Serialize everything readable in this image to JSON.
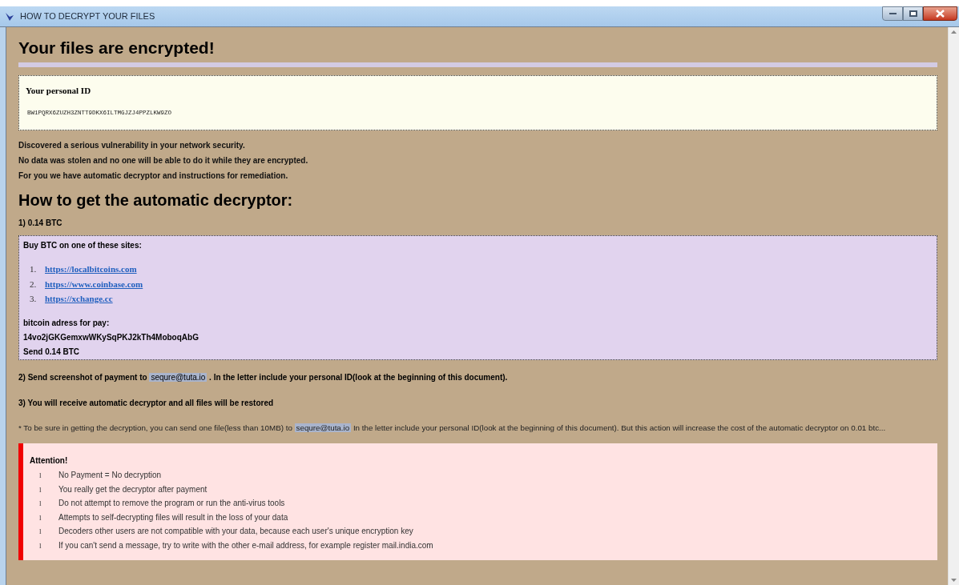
{
  "window": {
    "title": "HOW TO DECRYPT YOUR FILES"
  },
  "heading": "Your files are encrypted!",
  "id_box": {
    "label": "Your personal ID",
    "value": "BW1PQRX6ZUZH3ZNTT9DKX6ILTMGJZJ4PPZLKW9ZO"
  },
  "intro": [
    "Discovered a serious vulnerability in your network security.",
    "No data was stolen and no one will be able to do it while they are encrypted.",
    "For you we have automatic decryptor and instructions for remediation."
  ],
  "subheading": "How to get the automatic decryptor:",
  "step_1": "1) 0.14 BTC",
  "buy_box": {
    "title": "Buy BTC on one of these sites:",
    "sites": [
      {
        "number": "1.",
        "url": "https://localbitcoins.com"
      },
      {
        "number": "2.",
        "url": "https://www.coinbase.com"
      },
      {
        "number": "3.",
        "url": "https://xchange.cc"
      }
    ],
    "address_label": "bitcoin adress for pay:",
    "address": "14vo2jGKGemxwWKySqPKJ2kTh4MoboqAbG",
    "send": "Send 0.14 BTC"
  },
  "step_2": {
    "before": "2) Send screenshot of payment to",
    "email": "sequre@tuta.io",
    "after": ". In the letter include your personal ID(look at the beginning of this document)."
  },
  "step_3": "3) You will receive automatic decryptor and all files will be restored",
  "note": {
    "before": "* To be sure in getting the decryption, you can send one file(less than 10MB) to",
    "email": "sequre@tuta.io",
    "after": "In the letter include your personal ID(look at the beginning of this document). But this action will increase the cost of the automatic decryptor on 0.01 btc..."
  },
  "attention": {
    "title": "Attention!",
    "items": [
      {
        "marker": "l",
        "text": "No Payment = No decryption"
      },
      {
        "marker": "l",
        "text": "You really get the decryptor after payment"
      },
      {
        "marker": "l",
        "text": "Do not attempt to remove the program or run the anti-virus tools"
      },
      {
        "marker": "l",
        "text": "Attempts to self-decrypting files will result in the loss of your data"
      },
      {
        "marker": "l",
        "text": "Decoders other users are not compatible with your data, because each user's unique encryption key"
      },
      {
        "marker": "l",
        "text": "If you can't send a message, try to write with the other e-mail address, for example register mail.india.com"
      }
    ]
  }
}
